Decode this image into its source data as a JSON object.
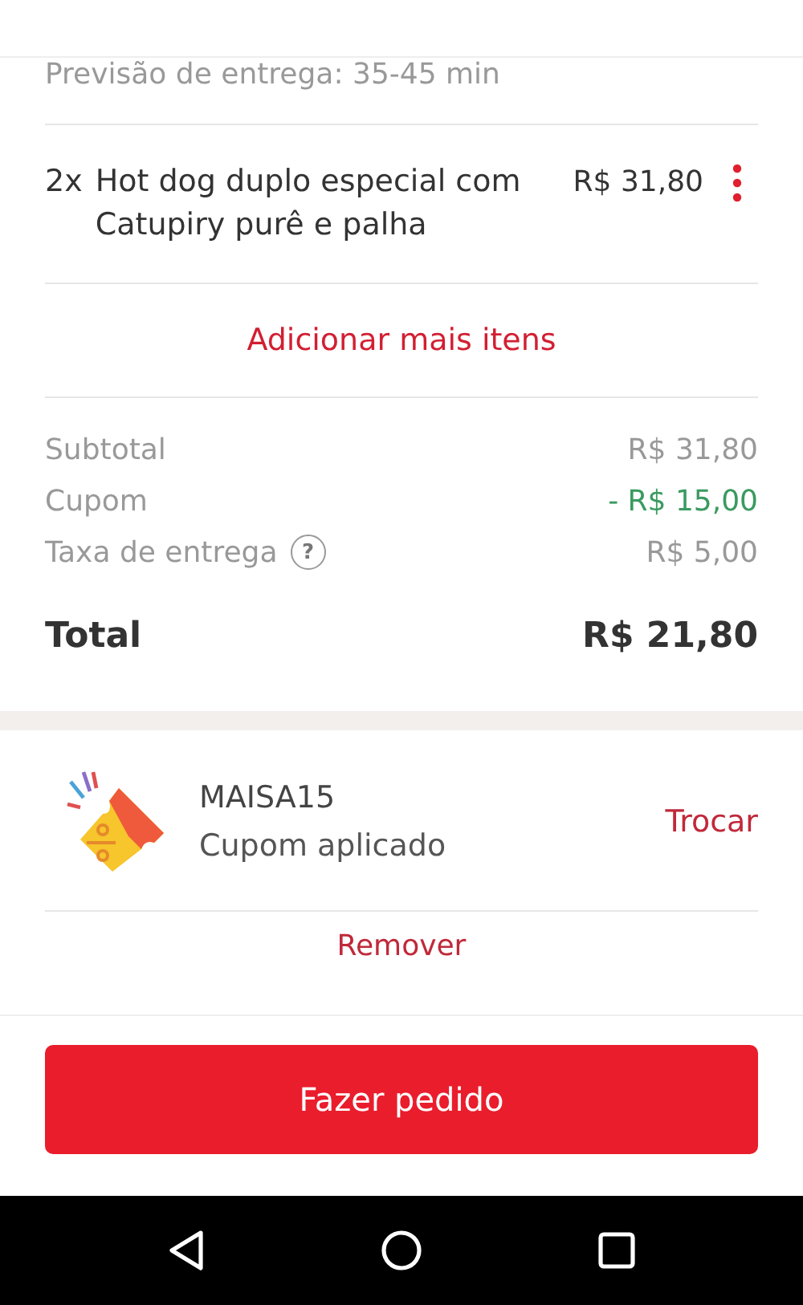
{
  "delivery_estimate": "Previsão de entrega: 35-45 min",
  "items": [
    {
      "quantity": "2x",
      "name": "Hot dog duplo especial com Catupiry purê e palha",
      "price": "R$ 31,80"
    }
  ],
  "add_more": "Adicionar mais itens",
  "summary": [
    {
      "kind": "plain",
      "label": "Subtotal",
      "value": "R$ 31,80"
    },
    {
      "kind": "discount",
      "label": "Cupom",
      "value": "- R$ 15,00"
    },
    {
      "kind": "help",
      "label": "Taxa de entrega",
      "help": "?",
      "value": "R$ 5,00"
    }
  ],
  "total": {
    "label": "Total",
    "value": "R$ 21,80"
  },
  "coupon": {
    "code": "MAISA15",
    "status": "Cupom aplicado",
    "change": "Trocar",
    "remove": "Remover"
  },
  "order_button": "Fazer pedido"
}
